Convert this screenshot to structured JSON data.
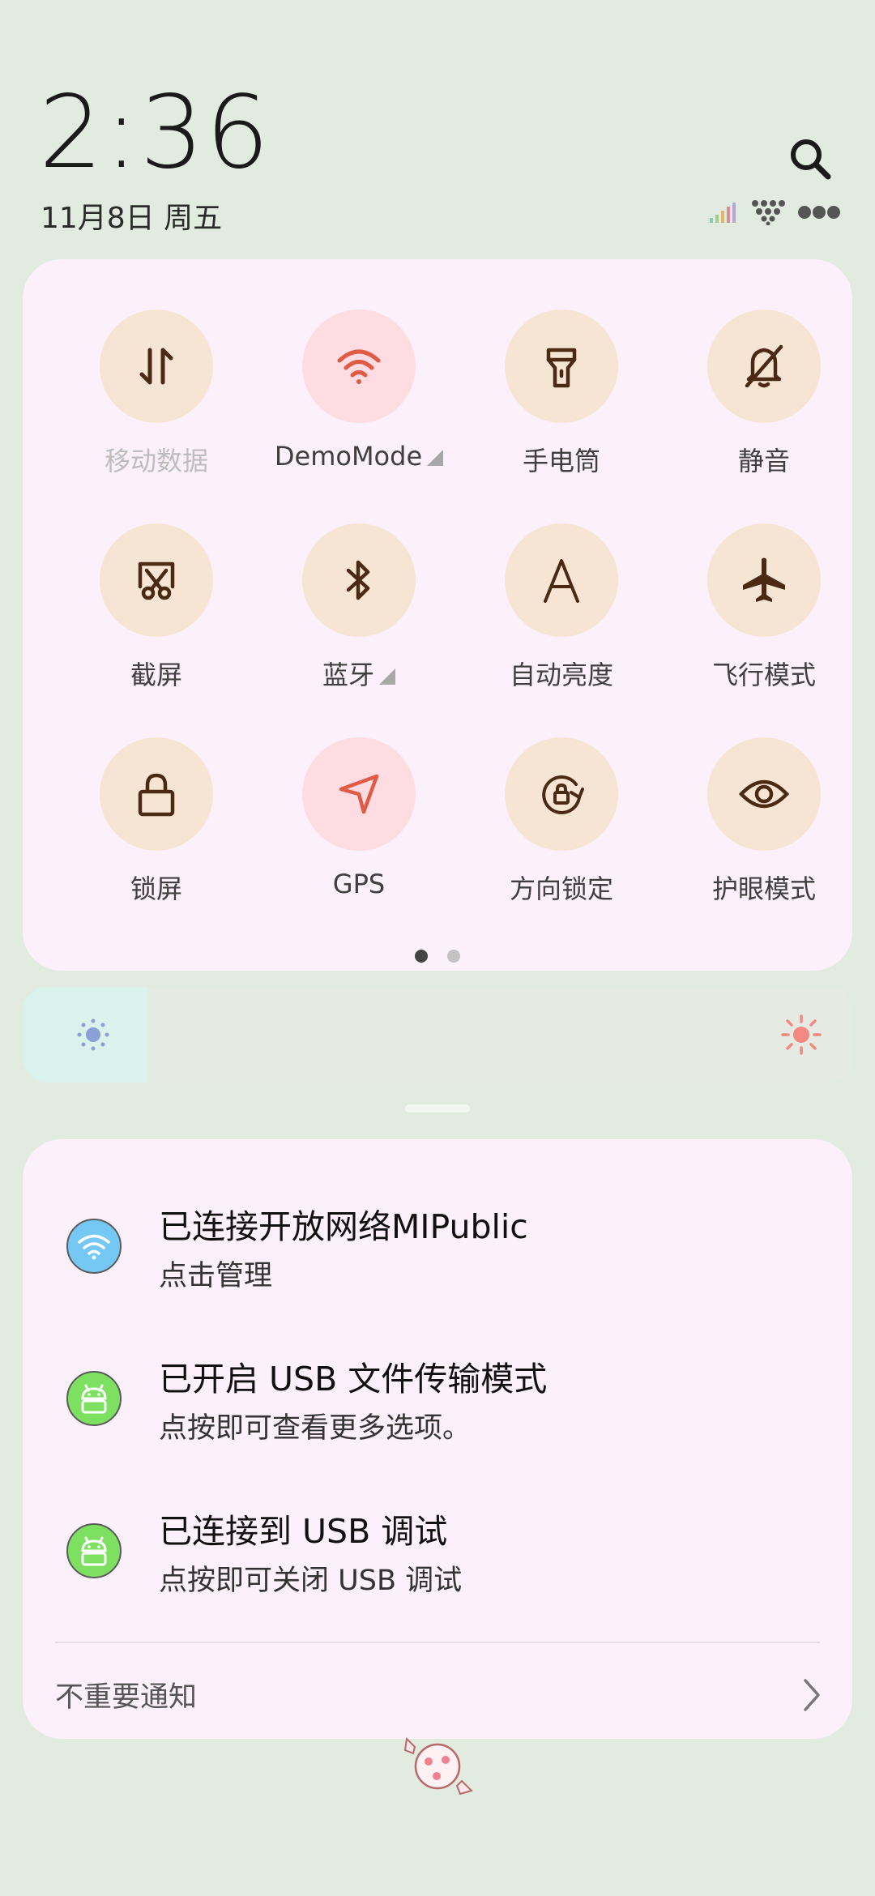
{
  "clock": {
    "time": "2:36",
    "date": "11月8日 周五"
  },
  "tiles": [
    {
      "label": "移动数据",
      "icon": "data-arrows-icon",
      "dim": true
    },
    {
      "label": "DemoMode",
      "icon": "wifi-icon",
      "active": true,
      "expandable": true
    },
    {
      "label": "手电筒",
      "icon": "flashlight-icon"
    },
    {
      "label": "静音",
      "icon": "bell-off-icon"
    },
    {
      "label": "截屏",
      "icon": "screenshot-icon"
    },
    {
      "label": "蓝牙",
      "icon": "bluetooth-icon",
      "expandable": true
    },
    {
      "label": "自动亮度",
      "icon": "auto-brightness-icon"
    },
    {
      "label": "飞行模式",
      "icon": "airplane-icon"
    },
    {
      "label": "锁屏",
      "icon": "lock-icon"
    },
    {
      "label": "GPS",
      "icon": "location-icon",
      "active": true
    },
    {
      "label": "方向锁定",
      "icon": "rotation-lock-icon"
    },
    {
      "label": "护眼模式",
      "icon": "eye-icon"
    }
  ],
  "pager": {
    "pages": 2,
    "current": 1
  },
  "brightness": {
    "level": 0.15
  },
  "notifications": [
    {
      "title": "已连接开放网络MIPublic",
      "subtitle": "点击管理",
      "icon": "wifi-icon"
    },
    {
      "title": "已开启  USB  文件传输模式",
      "subtitle": "点按即可查看更多选项。",
      "icon": "android-icon"
    },
    {
      "title": "已连接到  USB  调试",
      "subtitle": "点按即可关闭 USB 调试",
      "icon": "android-icon"
    }
  ],
  "footer": {
    "label": "不重要通知"
  },
  "colors": {
    "background": "#e1ebe0",
    "panel": "#fcf0fb",
    "tile": "#f7e5d4",
    "tile_active": "#fddce2",
    "accent": "#e05a46"
  }
}
